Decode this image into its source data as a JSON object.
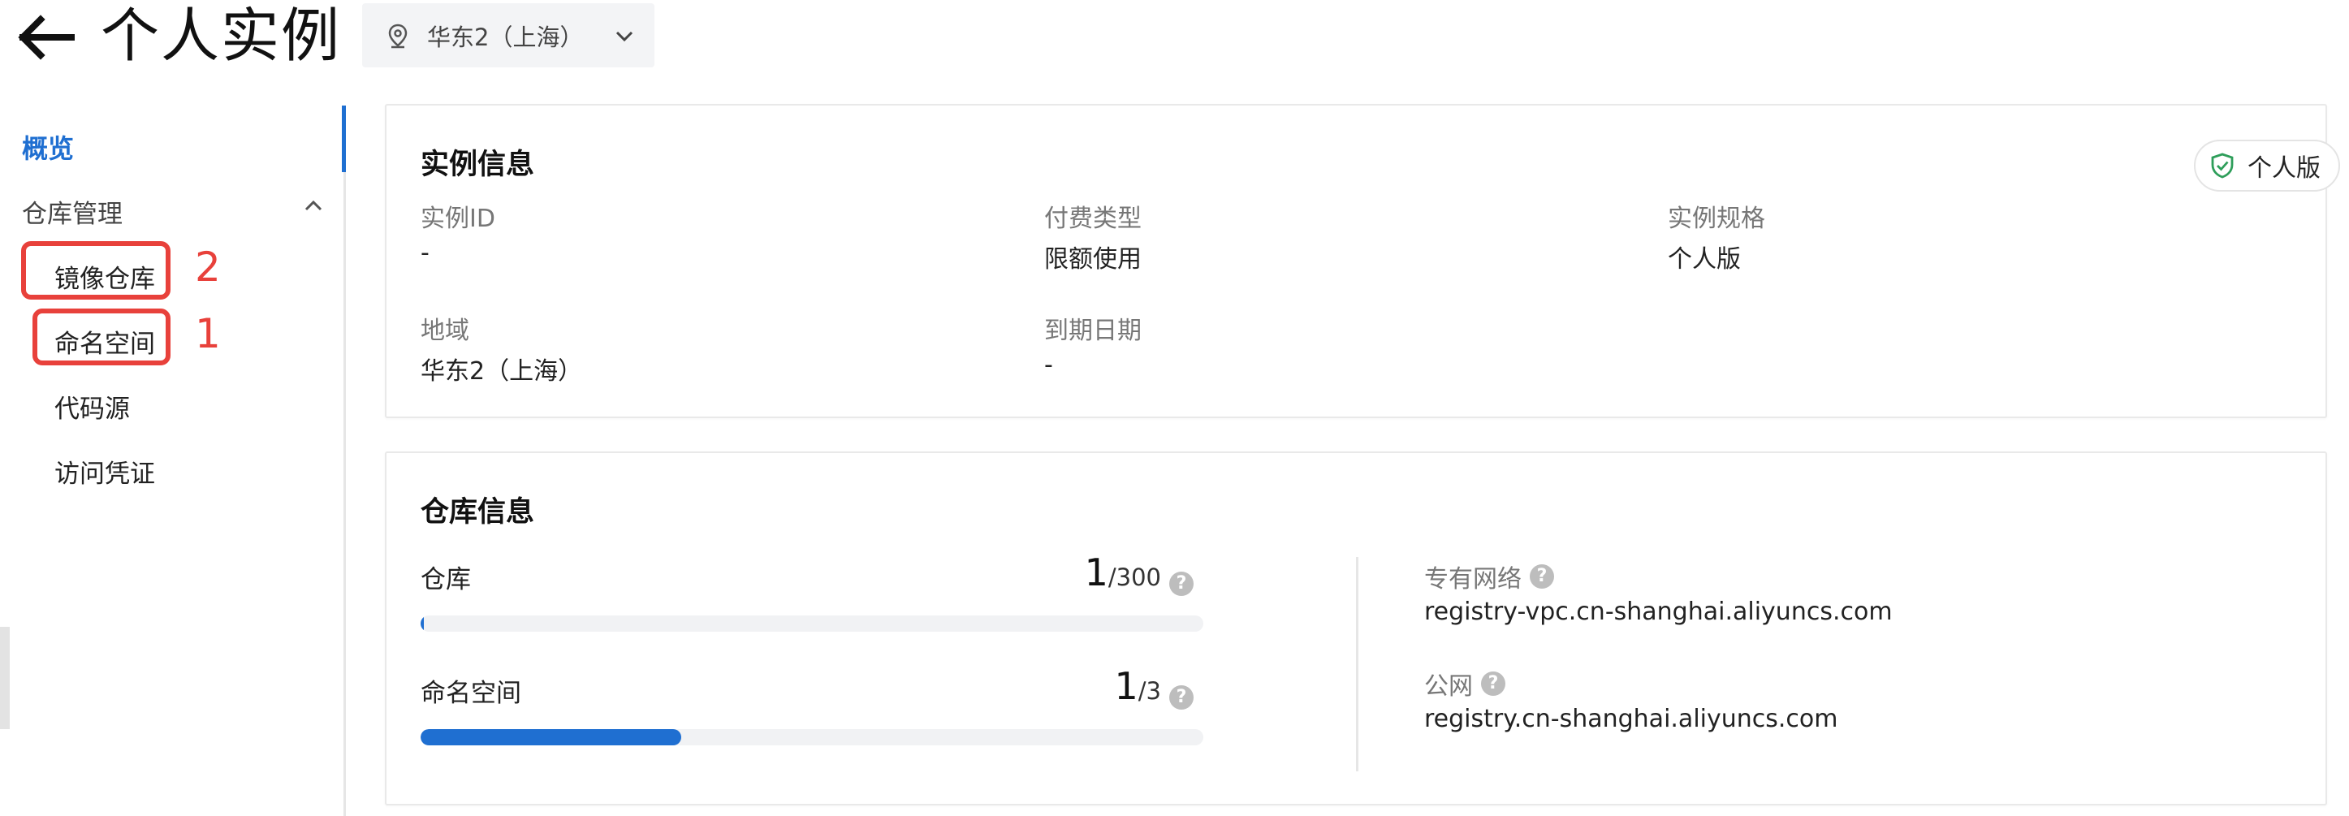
{
  "header": {
    "title": "个人实例",
    "region": "华东2（上海）"
  },
  "sidebar": {
    "overview": "概览",
    "group_label": "仓库管理",
    "items": [
      {
        "label": "镜像仓库"
      },
      {
        "label": "命名空间"
      },
      {
        "label": "代码源"
      },
      {
        "label": "访问凭证"
      }
    ],
    "annotations": [
      {
        "label": "2"
      },
      {
        "label": "1"
      }
    ]
  },
  "instance_info": {
    "title": "实例信息",
    "edition_badge": "个人版",
    "fields": [
      {
        "label": "实例ID",
        "value": "-"
      },
      {
        "label": "付费类型",
        "value": "限额使用"
      },
      {
        "label": "实例规格",
        "value": "个人版"
      },
      {
        "label": "地域",
        "value": "华东2（上海）"
      },
      {
        "label": "到期日期",
        "value": "-"
      }
    ]
  },
  "repo_info": {
    "title": "仓库信息",
    "quotas": [
      {
        "label": "仓库",
        "used": "1",
        "total": "/300",
        "fraction": 0.0033
      },
      {
        "label": "命名空间",
        "used": "1",
        "total": "/3",
        "fraction": 0.3333
      }
    ],
    "networks": [
      {
        "label": "专有网络",
        "value": "registry-vpc.cn-shanghai.aliyuncs.com"
      },
      {
        "label": "公网",
        "value": "registry.cn-shanghai.aliyuncs.com"
      }
    ],
    "help_glyph": "?"
  },
  "colors": {
    "accent": "#1f6fd1",
    "annotation": "#e8413b",
    "badge_shield": "#2e9e5a"
  },
  "icons": {
    "back": "arrow-left-icon",
    "region": "location-pin-icon",
    "dropdown": "chevron-down-icon",
    "group": "chevron-up-icon",
    "badge": "shield-check-icon",
    "help": "question-circle-icon"
  }
}
